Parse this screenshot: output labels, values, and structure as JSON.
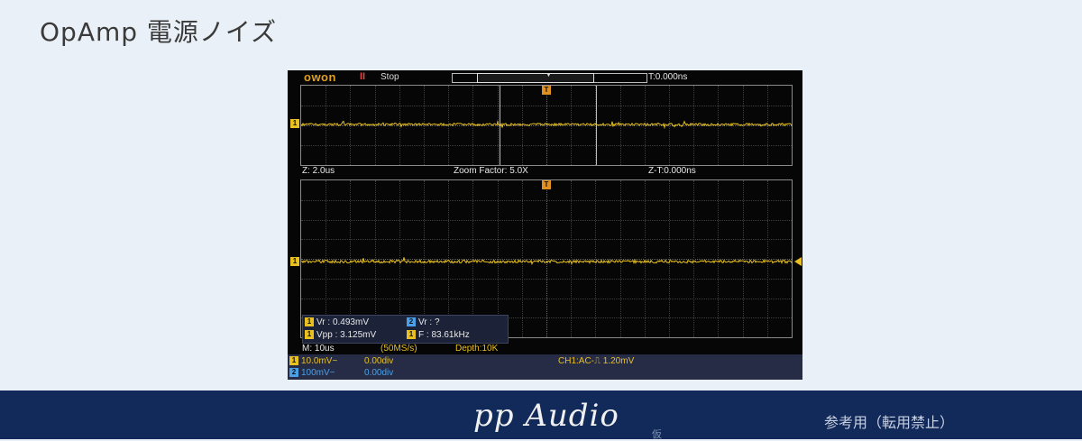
{
  "page": {
    "title": "OpAmp 電源ノイズ"
  },
  "scope": {
    "brand": "owon",
    "run_mark": "II",
    "status": "Stop",
    "trigger_position": "T:0.000ns",
    "zoom_info": {
      "time_base": "Z: 2.0us",
      "zoom_factor": "Zoom Factor: 5.0X",
      "zoom_trigger_time": "Z-T:0.000ns"
    },
    "markers": {
      "ch1": "1",
      "trigger": "T"
    },
    "measurements": [
      {
        "channel": "1",
        "text": "Vr : 0.493mV"
      },
      {
        "channel": "2",
        "text": "Vr :     ?"
      },
      {
        "channel": "1",
        "text": "Vpp : 3.125mV"
      },
      {
        "channel": "1",
        "text": "F : 83.61kHz"
      }
    ],
    "bottom": {
      "main_time": "M: 10us",
      "sample_rate": "(50MS/s)",
      "depth": "Depth:10K"
    },
    "channels": [
      {
        "number": "1",
        "scale": "10.0mV~",
        "offset": "0.00div"
      },
      {
        "number": "2",
        "scale": "100mV~",
        "offset": "0.00div"
      }
    ],
    "trigger_info": "CH1:AC-⎍ 1.20mV"
  },
  "footer": {
    "brand": "pp Audio",
    "tentative": "仮",
    "note": "参考用（転用禁止）"
  },
  "colors": {
    "ch1": "#e8c020",
    "ch2": "#4aa0e8",
    "trigger": "#e09020",
    "footer_bg": "#122a5a",
    "page_bg": "#eaf0f7"
  }
}
